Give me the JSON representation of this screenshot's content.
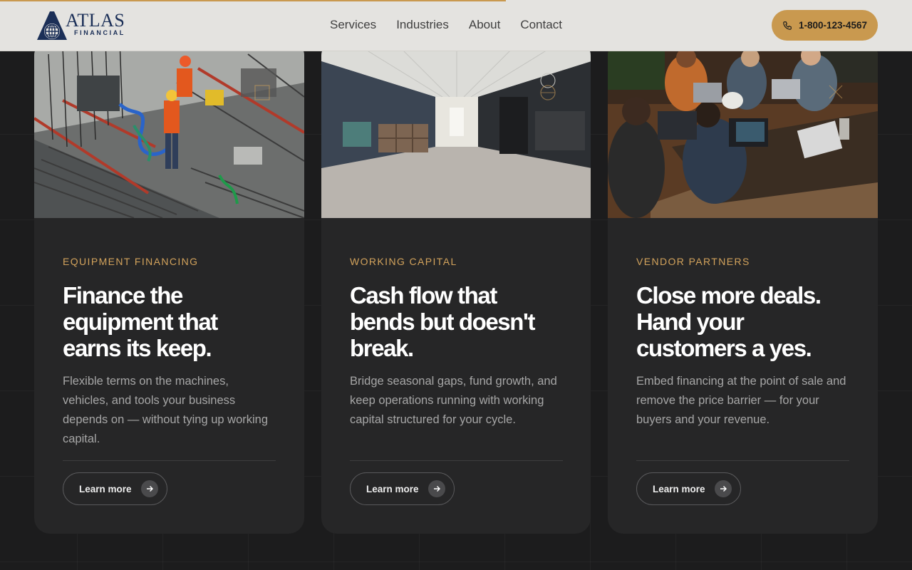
{
  "brand": {
    "name_line1": "ATLAS",
    "name_line2": "FINANCIAL",
    "colors": {
      "navy": "#1b2f57",
      "accent": "#c9994f",
      "accent_text": "#d3a35c"
    }
  },
  "progress": {
    "fraction": 0.555
  },
  "nav": {
    "items": [
      {
        "label": "Services"
      },
      {
        "label": "Industries"
      },
      {
        "label": "About"
      },
      {
        "label": "Contact"
      }
    ]
  },
  "header": {
    "phone_label": "1-800-123-4567",
    "phone_icon": "phone-icon"
  },
  "cards": [
    {
      "eyebrow": "Equipment Financing",
      "title": "Finance the equipment that earns its keep.",
      "description": "Flexible terms on the machines, vehicles, and tools your business depends on — without tying up working capital.",
      "cta": "Learn more",
      "image": "construction-site-photo",
      "overlay_icon": "square-outline-icon"
    },
    {
      "eyebrow": "Working Capital",
      "title": "Cash flow that bends but doesn't break.",
      "description": "Bridge seasonal gaps, fund growth, and keep operations running with working capital structured for your cycle.",
      "cta": "Learn more",
      "image": "office-hallway-photo",
      "overlay_icon": "circle-crosshair-icon"
    },
    {
      "eyebrow": "Vendor Partners",
      "title": "Close more deals. Hand your customers a yes.",
      "description": "Embed financing at the point of sale and remove the price barrier — for your buyers and your revenue.",
      "cta": "Learn more",
      "image": "team-laptops-photo",
      "overlay_icon": "x-mark-icon"
    }
  ]
}
